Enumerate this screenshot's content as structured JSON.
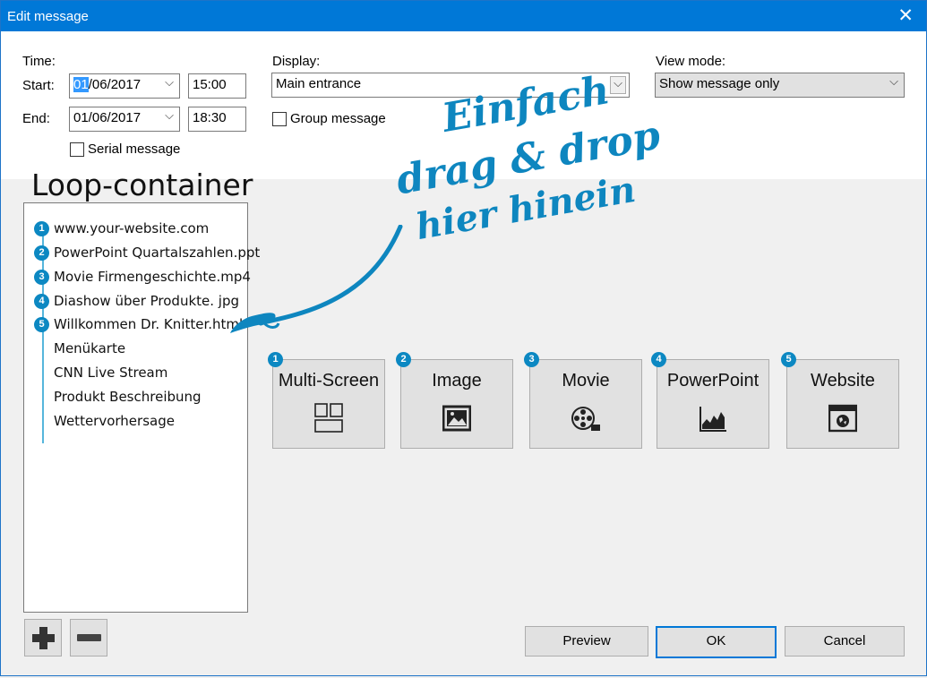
{
  "window": {
    "title": "Edit message",
    "close_glyph": "✕"
  },
  "time": {
    "label": "Time:",
    "start_label": "Start:",
    "start_date_sel": "01",
    "start_date_rest": "/06/2017",
    "start_time": "15:00",
    "end_label": "End:",
    "end_date": "01/06/2017",
    "end_time": "18:30",
    "serial_label": "Serial message"
  },
  "display": {
    "label": "Display:",
    "value": "Main entrance",
    "group_label": "Group message"
  },
  "view_mode": {
    "label": "View mode:",
    "value": "Show message only"
  },
  "loop": {
    "title": "Loop-container",
    "items": [
      {
        "num": "1",
        "label": "www.your-website.com"
      },
      {
        "num": "2",
        "label": "PowerPoint Quartalszahlen.ppt"
      },
      {
        "num": "3",
        "label": "Movie Firmengeschichte.mp4"
      },
      {
        "num": "4",
        "label": "Diashow über Produkte. jpg"
      },
      {
        "num": "5",
        "label": "Willkommen Dr. Knitter.html"
      },
      {
        "num": "",
        "label": "Menükarte"
      },
      {
        "num": "",
        "label": "CNN Live Stream"
      },
      {
        "num": "",
        "label": "Produkt Beschreibung"
      },
      {
        "num": "",
        "label": "Wettervorhersage"
      }
    ]
  },
  "annotation": {
    "line1": "Einfach",
    "line2": "drag & drop",
    "line3": "hier hinein"
  },
  "tiles": [
    {
      "num": "1",
      "label": "Multi-Screen",
      "icon": "multi-screen-icon"
    },
    {
      "num": "2",
      "label": "Image",
      "icon": "image-icon"
    },
    {
      "num": "3",
      "label": "Movie",
      "icon": "movie-reel-icon"
    },
    {
      "num": "4",
      "label": "PowerPoint",
      "icon": "chart-icon"
    },
    {
      "num": "5",
      "label": "Website",
      "icon": "globe-window-icon"
    }
  ],
  "buttons": {
    "preview": "Preview",
    "ok": "OK",
    "cancel": "Cancel"
  },
  "colors": {
    "accent": "#0078d7",
    "badge": "#0c88c2",
    "annotation": "#0e86bf"
  }
}
